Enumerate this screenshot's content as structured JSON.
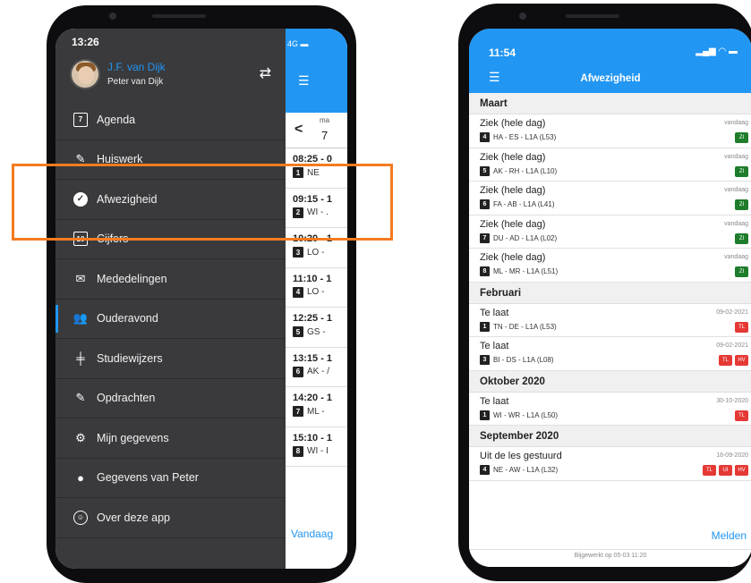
{
  "left_phone": {
    "status_time": "13:26",
    "network": "4G",
    "user_name": "J.F. van Dijk",
    "child_name": "Peter van Dijk",
    "menu": [
      {
        "label": "Agenda",
        "icon": "calendar-icon",
        "glyph": "7"
      },
      {
        "label": "Huiswerk",
        "icon": "homework-icon",
        "glyph": "✎"
      },
      {
        "label": "Afwezigheid",
        "icon": "checkmark-icon",
        "glyph": "✓"
      },
      {
        "label": "Cijfers",
        "icon": "grades-icon",
        "glyph": "10"
      },
      {
        "label": "Mededelingen",
        "icon": "envelope-icon",
        "glyph": "✉"
      },
      {
        "label": "Ouderavond",
        "icon": "parents-evening-icon",
        "glyph": "👥"
      },
      {
        "label": "Studiewijzers",
        "icon": "signpost-icon",
        "glyph": "╪"
      },
      {
        "label": "Opdrachten",
        "icon": "assignment-icon",
        "glyph": "✎"
      },
      {
        "label": "Mijn gegevens",
        "icon": "gear-icon",
        "glyph": "⚙"
      },
      {
        "label": "Gegevens van Peter",
        "icon": "person-icon",
        "glyph": "●"
      },
      {
        "label": "Over deze app",
        "icon": "info-icon",
        "glyph": "☺"
      }
    ],
    "agenda": {
      "day_name": "ma",
      "day_number": "7",
      "lessons": [
        {
          "time": "08:25 - 0",
          "num": "1",
          "subject": "NE"
        },
        {
          "time": "09:15 - 1",
          "num": "2",
          "subject": "WI - ."
        },
        {
          "time": "10:20 - 1",
          "num": "3",
          "subject": "LO -"
        },
        {
          "time": "11:10 - 1",
          "num": "4",
          "subject": "LO -"
        },
        {
          "time": "12:25 - 1",
          "num": "5",
          "subject": "GS -"
        },
        {
          "time": "13:15 - 1",
          "num": "6",
          "subject": "AK - /"
        },
        {
          "time": "14:20 - 1",
          "num": "7",
          "subject": "ML -"
        },
        {
          "time": "15:10 - 1",
          "num": "8",
          "subject": "WI - I"
        }
      ],
      "today_label": "Vandaag"
    }
  },
  "right_phone": {
    "status_time": "11:54",
    "title": "Afwezigheid",
    "sections": [
      {
        "month": "Maart",
        "items": [
          {
            "reason": "Ziek (hele dag)",
            "num": "4",
            "detail": "HA - ES - L1A (L53)",
            "date": "vandaag",
            "badges": [
              {
                "text": "ZI",
                "color": "green"
              }
            ]
          },
          {
            "reason": "Ziek (hele dag)",
            "num": "5",
            "detail": "AK - RH - L1A (L10)",
            "date": "vandaag",
            "badges": [
              {
                "text": "ZI",
                "color": "green"
              }
            ]
          },
          {
            "reason": "Ziek (hele dag)",
            "num": "6",
            "detail": "FA - AB - L1A (L41)",
            "date": "vandaag",
            "badges": [
              {
                "text": "ZI",
                "color": "green"
              }
            ]
          },
          {
            "reason": "Ziek (hele dag)",
            "num": "7",
            "detail": "DU - AD - L1A (L02)",
            "date": "vandaag",
            "badges": [
              {
                "text": "ZI",
                "color": "green"
              }
            ]
          },
          {
            "reason": "Ziek (hele dag)",
            "num": "8",
            "detail": "ML - MR - L1A (L51)",
            "date": "vandaag",
            "badges": [
              {
                "text": "ZI",
                "color": "green"
              }
            ]
          }
        ]
      },
      {
        "month": "Februari",
        "items": [
          {
            "reason": "Te laat",
            "num": "1",
            "detail": "TN - DE - L1A (L53)",
            "date": "09-02-2021",
            "badges": [
              {
                "text": "TL",
                "color": "red"
              }
            ]
          },
          {
            "reason": "Te laat",
            "num": "3",
            "detail": "BI - DS - L1A (L08)",
            "date": "09-02-2021",
            "badges": [
              {
                "text": "TL",
                "color": "red"
              },
              {
                "text": "HV",
                "color": "red"
              }
            ]
          }
        ]
      },
      {
        "month": "Oktober 2020",
        "items": [
          {
            "reason": "Te laat",
            "num": "1",
            "detail": "WI - WR - L1A (L50)",
            "date": "30-10-2020",
            "badges": [
              {
                "text": "TL",
                "color": "red"
              }
            ]
          }
        ]
      },
      {
        "month": "September 2020",
        "items": [
          {
            "reason": "Uit de les gestuurd",
            "num": "4",
            "detail": "NE - AW - L1A (L32)",
            "date": "16-09-2020",
            "badges": [
              {
                "text": "TL",
                "color": "red"
              },
              {
                "text": "UI",
                "color": "red"
              },
              {
                "text": "HV",
                "color": "red"
              }
            ]
          }
        ]
      }
    ],
    "action_label": "Melden",
    "updated_text": "Bijgewerkt op 05-03 11:20"
  },
  "colors": {
    "accent": "#2196f3",
    "drawer_bg": "#3a3a3c",
    "highlight": "#f47b20",
    "badge_green": "#1e7d2a",
    "badge_red": "#e53935"
  }
}
